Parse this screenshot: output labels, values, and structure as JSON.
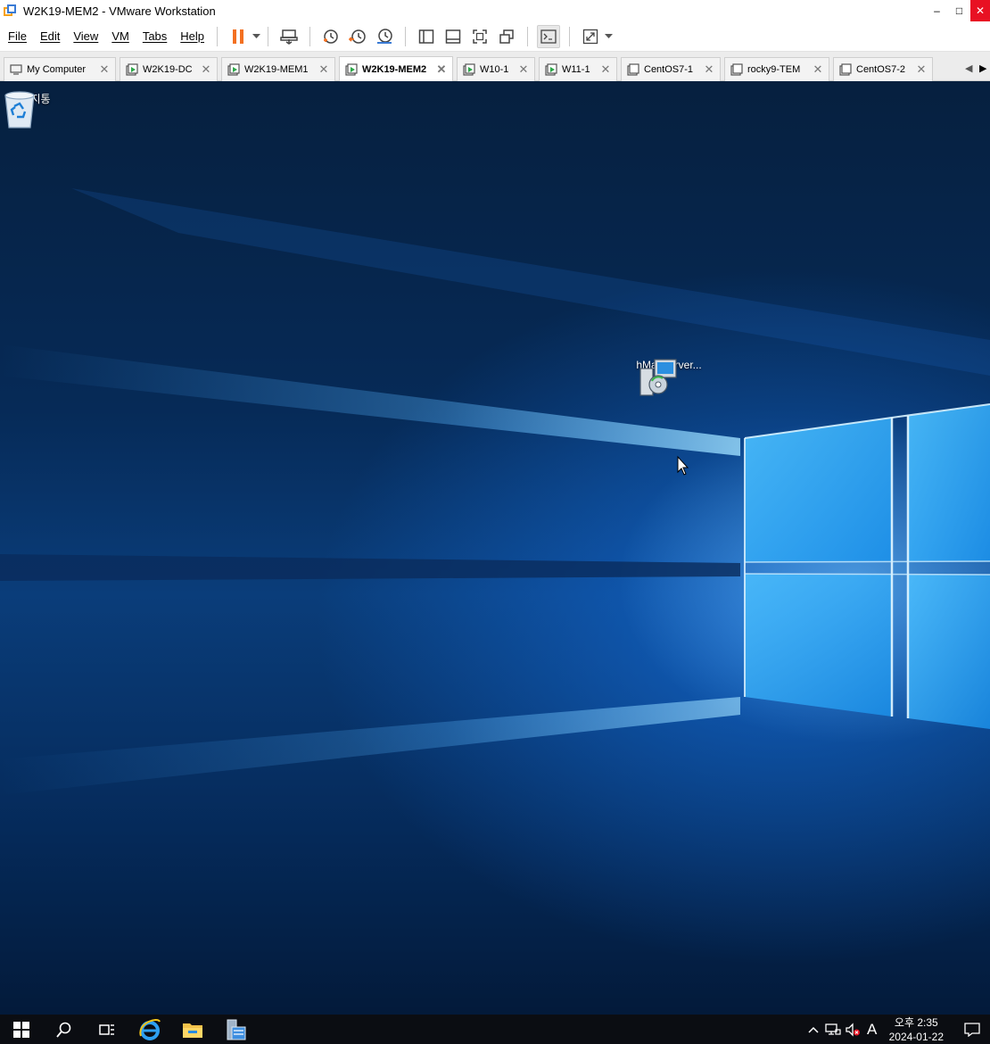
{
  "window": {
    "title": "W2K19-MEM2 - VMware Workstation"
  },
  "menu": [
    "File",
    "Edit",
    "View",
    "VM",
    "Tabs",
    "Help"
  ],
  "tabs": [
    {
      "label": "My Computer",
      "active": false
    },
    {
      "label": "W2K19-DC",
      "active": false
    },
    {
      "label": "W2K19-MEM1",
      "active": false
    },
    {
      "label": "W2K19-MEM2",
      "active": true
    },
    {
      "label": "W10-1",
      "active": false
    },
    {
      "label": "W11-1",
      "active": false
    },
    {
      "label": "CentOS7-1",
      "active": false
    },
    {
      "label": "rocky9-TEM",
      "active": false
    },
    {
      "label": "CentOS7-2",
      "active": false
    }
  ],
  "desktop": {
    "icons": [
      {
        "label": "휴지통",
        "icon": "recycle-bin-icon"
      },
      {
        "label": "hMailServer...",
        "icon": "installer-icon"
      }
    ]
  },
  "taskbar": {
    "clock_time": "오후 2:35",
    "clock_date": "2024-01-22",
    "ime": "A"
  },
  "colors": {
    "accent": "#0078d7",
    "close": "#e81123",
    "pause": "#f37021"
  }
}
